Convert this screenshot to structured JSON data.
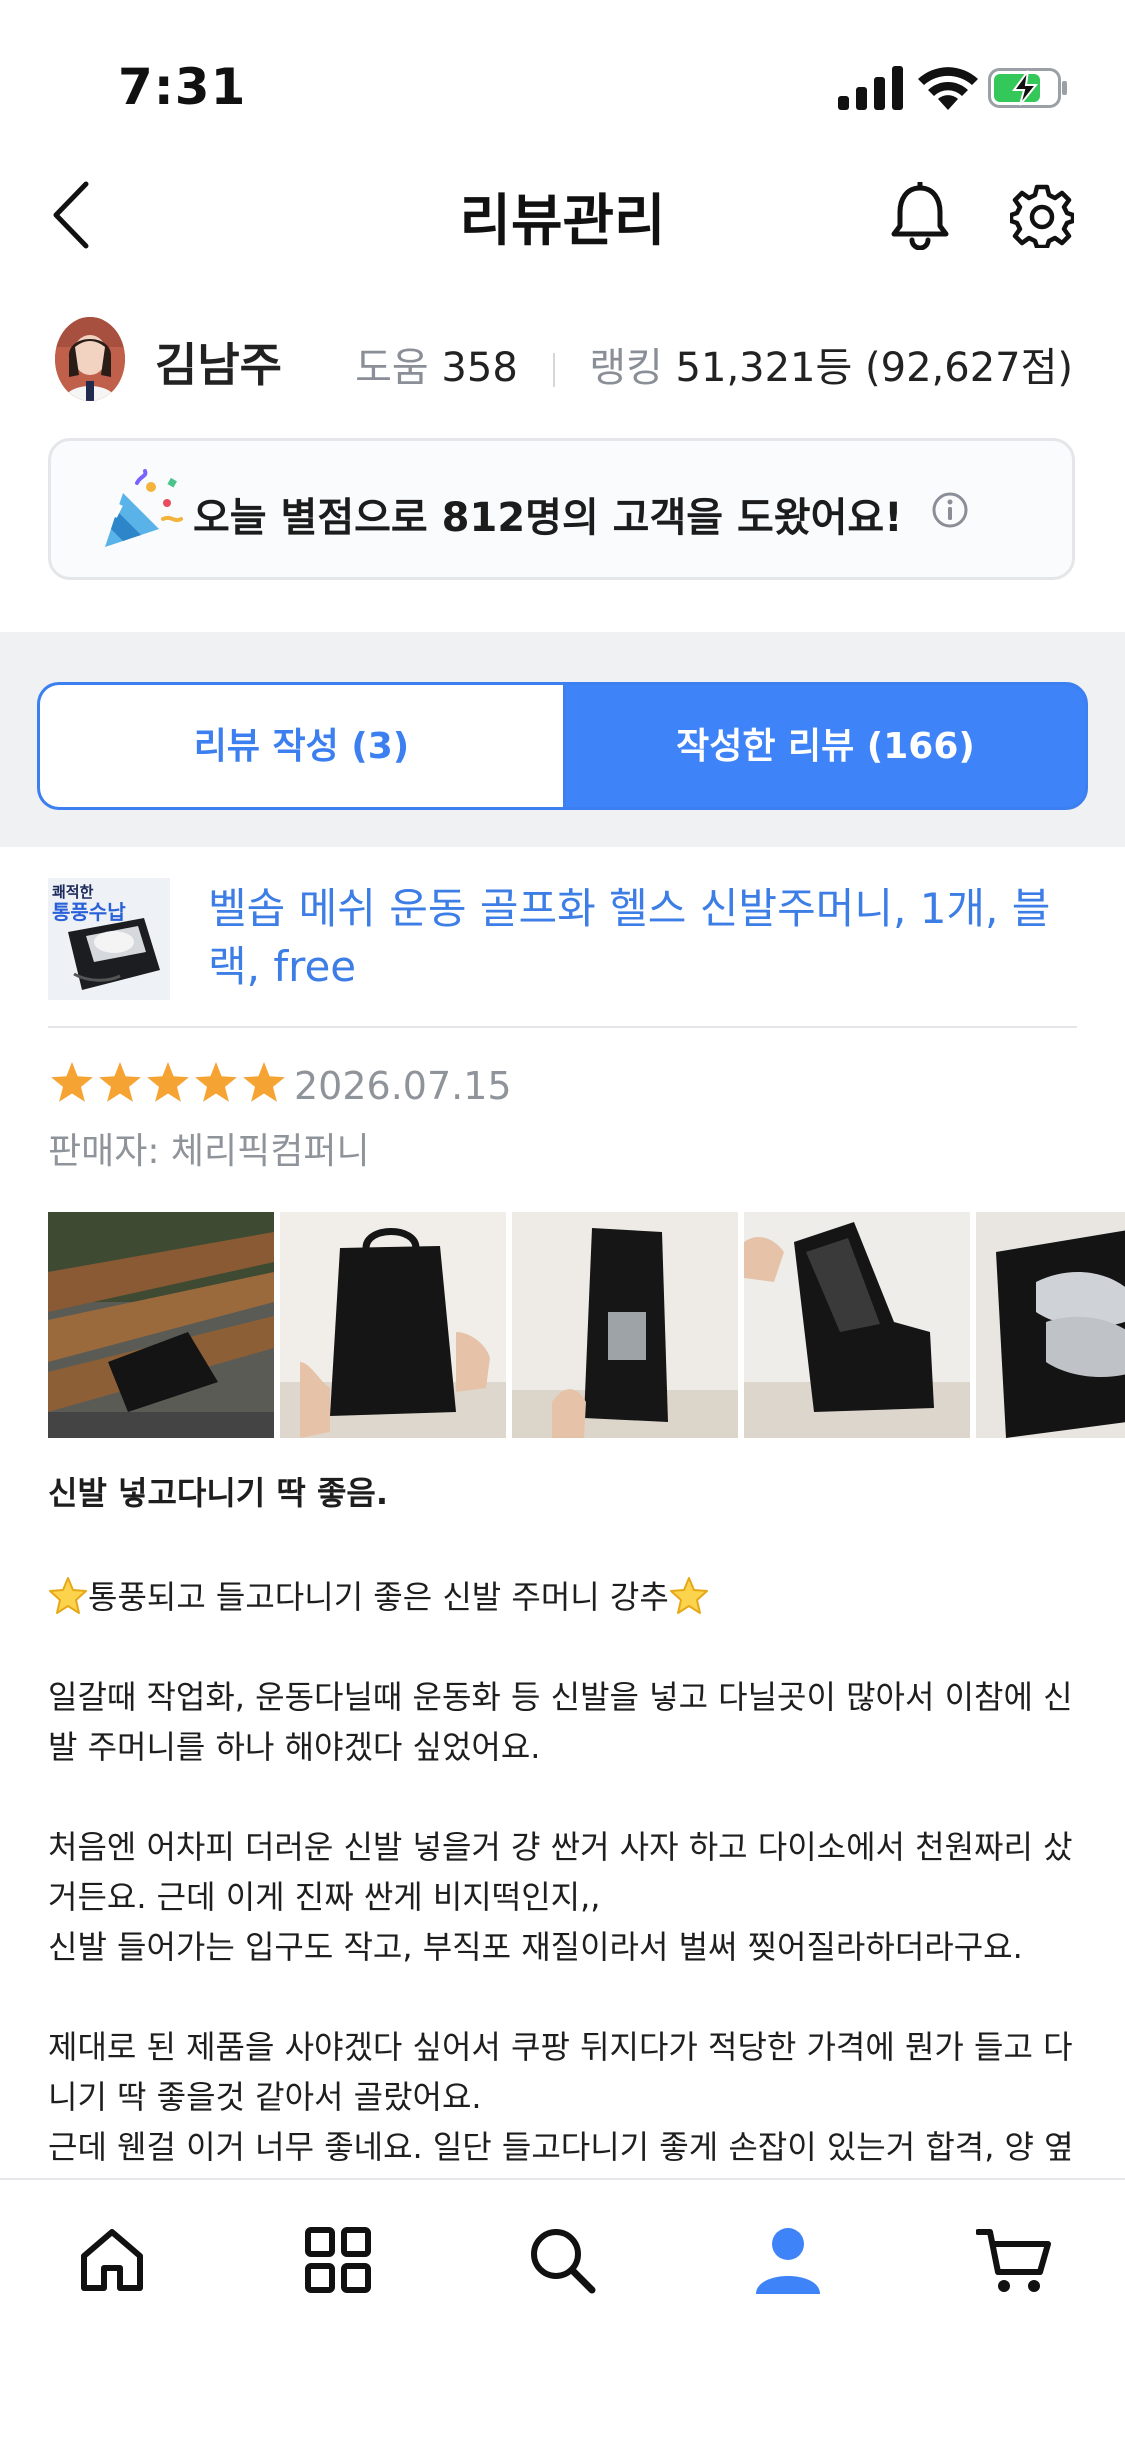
{
  "status_bar": {
    "time": "7:31"
  },
  "header": {
    "title": "리뷰관리"
  },
  "profile": {
    "name": "김남주",
    "help_label": "도움",
    "help_count": "358",
    "ranking_label": "랭킹",
    "ranking_value": "51,321등 (92,627점)"
  },
  "banner": {
    "text": "오늘 별점으로 812명의 고객을 도왔어요!"
  },
  "tabs": [
    {
      "label": "리뷰 작성 (3)",
      "active": false
    },
    {
      "label": "작성한 리뷰 (166)",
      "active": true
    }
  ],
  "product": {
    "name": "벨솝 메쉬 운동 골프화 헬스 신발주머니, 1개, 블랙, free",
    "thumb_text_1": "쾌적한",
    "thumb_text_2": "통풍수납"
  },
  "review": {
    "rating": 5,
    "date": "2026.07.15",
    "seller": "판매자: 체리픽컴퍼니",
    "title": "신발 넣고다니기 딱 좋음.",
    "headline": "통풍되고 들고다니기 좋은 신발 주머니 강추",
    "paragraphs": [
      "일갈때 작업화, 운동다닐때 운동화 등 신발을 넣고 다닐곳이 많아서 이참에 신발 주머니를 하나 해야겠다 싶었어요.",
      "처음엔 어차피 더러운 신발 넣을거 걍 싼거 사자 하고 다이소에서 천원짜리 샀거든요. 근데 이게 진짜 싼게 비지떡인지,,\n신발 들어가는 입구도 작고, 부직포 재질이라서 벌써 찢어질라하더라구요.",
      "제대로 된 제품을 사야겠다 싶어서 쿠팡 뒤지다가 적당한 가격에 뭔가 들고 다니기 딱 좋을것 같아서 골랐어요.\n근데 웬걸 이거 너무 좋네요. 일단 들고다니기 좋게 손잡이 있는거 합격, 양 옆에 통풍되는 기능 합격, 신발들어가는 입구 크게 지퍼로 되어있는거 완전"
    ]
  },
  "colors": {
    "accent": "#3f83f8",
    "star": "#f5a332"
  },
  "nav_icons": [
    "home-icon",
    "categories-icon",
    "search-icon",
    "my-page-icon",
    "cart-icon"
  ]
}
